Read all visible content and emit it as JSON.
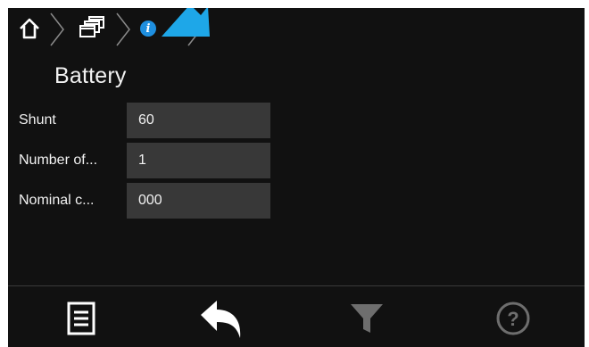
{
  "breadcrumb": {
    "items": [
      {
        "name": "home",
        "icon": "home-icon"
      },
      {
        "name": "windows",
        "icon": "windows-stack-icon"
      },
      {
        "name": "info",
        "icon": "info-icon",
        "glyph": "i"
      }
    ]
  },
  "page": {
    "title": "Battery"
  },
  "fields": [
    {
      "label": "Shunt",
      "value": "60"
    },
    {
      "label": "Number of...",
      "value": "1"
    },
    {
      "label": "Nominal c...",
      "value": "000"
    }
  ],
  "toolbar": {
    "menu_icon": "menu-list-icon",
    "back_icon": "back-arrow-icon",
    "filter_icon": "filter-icon",
    "help_icon": "help-icon",
    "help_glyph": "?"
  },
  "colors": {
    "background": "#111111",
    "field": "#383838",
    "text": "#f2f2f2",
    "accent": "#1e8fe0",
    "pointer": "#1ea7e8",
    "disabled": "#6e6e6e"
  }
}
